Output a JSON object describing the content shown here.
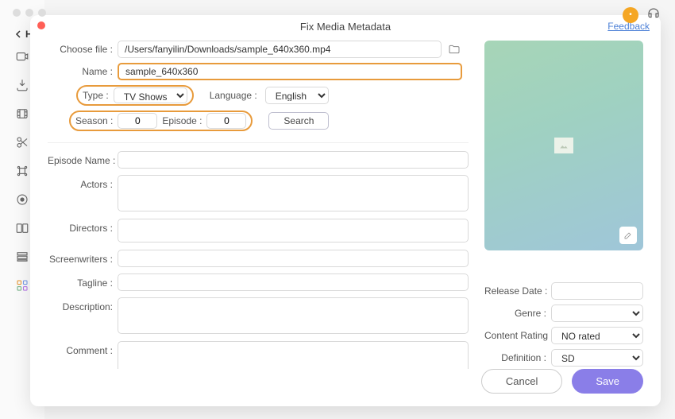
{
  "header": {
    "home_label": "Ho",
    "avatar_initial": "•"
  },
  "modal": {
    "title": "Fix Media Metadata",
    "feedback": "Feedback"
  },
  "labels": {
    "choose_file": "Choose file :",
    "name": "Name :",
    "type": "Type :",
    "language": "Language :",
    "season": "Season :",
    "episode": "Episode :",
    "search": "Search",
    "episode_name": "Episode Name :",
    "actors": "Actors :",
    "directors": "Directors :",
    "screenwriters": "Screenwriters :",
    "tagline": "Tagline :",
    "description": "Description:",
    "comment": "Comment :",
    "release_date": "Release Date :",
    "genre": "Genre :",
    "content_rating": "Content Rating :",
    "definition": "Definition :"
  },
  "values": {
    "file_path": "/Users/fanyilin/Downloads/sample_640x360.mp4",
    "name": "sample_640x360",
    "type": "TV Shows",
    "language": "English",
    "season": "0",
    "episode": "0",
    "episode_name": "",
    "actors": "",
    "directors": "",
    "screenwriters": "",
    "tagline": "",
    "description": "",
    "comment": "",
    "release_date": "",
    "genre": "",
    "content_rating": "NO rated",
    "definition": "SD"
  },
  "buttons": {
    "cancel": "Cancel",
    "save": "Save"
  }
}
